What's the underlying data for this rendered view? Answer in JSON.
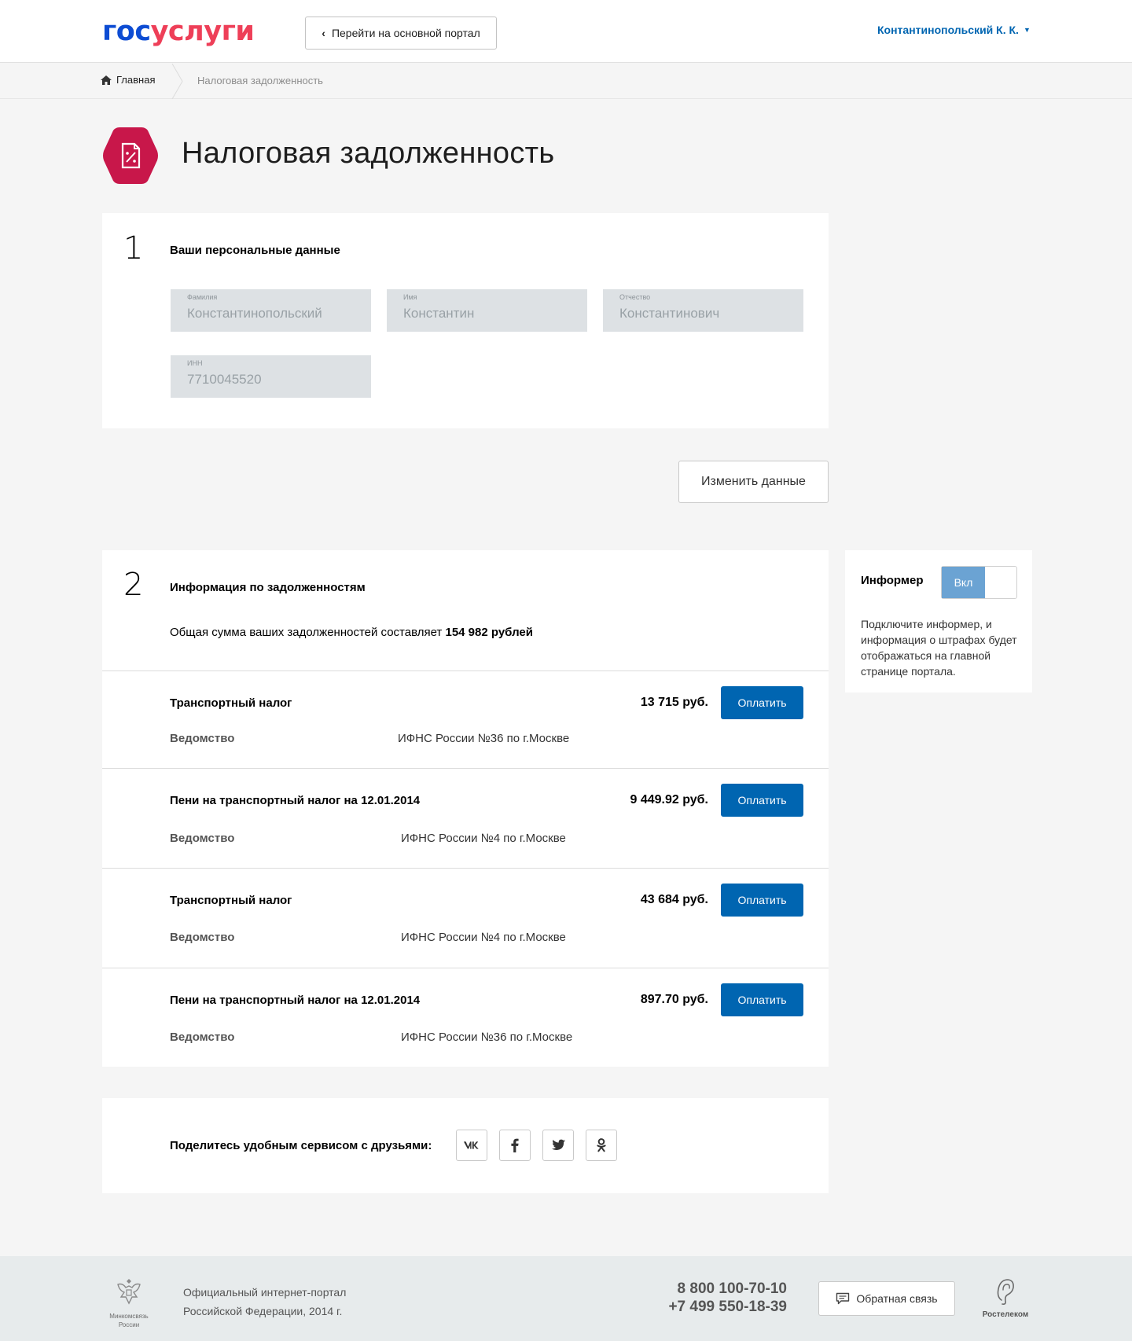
{
  "header": {
    "logo_part1": "гос",
    "logo_part2": "услуги",
    "portal_button": "Перейти на основной портал",
    "user_name": "Контантинопольский К. К."
  },
  "breadcrumb": {
    "home": "Главная",
    "current": "Налоговая задолженность"
  },
  "page_title": "Налоговая задолженность",
  "section1": {
    "number": "1",
    "heading": "Ваши персональные данные",
    "fields": [
      {
        "label": "Фамилия",
        "value": "Константинопольский"
      },
      {
        "label": "Имя",
        "value": "Константин"
      },
      {
        "label": "Отчество",
        "value": "Константинович"
      },
      {
        "label": "ИНН",
        "value": "7710045520"
      }
    ],
    "edit_button": "Изменить данные"
  },
  "section2": {
    "number": "2",
    "heading": "Информация по задолженностям",
    "total_prefix": "Общая сумма ваших задолженностей составляет",
    "total_amount": "154 982 рублей",
    "pay_label": "Оплатить",
    "dept_label": "Ведомство",
    "debts": [
      {
        "title": "Транспортный налог",
        "amount": "13 715 руб.",
        "department": "ИФНС России №36 по г.Москве"
      },
      {
        "title": "Пени на транспортный налог на 12.01.2014",
        "amount": "9 449.92 руб.",
        "department": "ИФНС России №4 по г.Москве"
      },
      {
        "title": "Транспортный налог",
        "amount": "43 684 руб.",
        "department": "ИФНС России №4 по г.Москве"
      },
      {
        "title": "Пени на транспортный налог на 12.01.2014",
        "amount": "897.70 руб.",
        "department": "ИФНС России №36 по г.Москве"
      }
    ]
  },
  "informer": {
    "title": "Информер",
    "toggle_on": "Вкл",
    "text": "Подключите информер, и информация о штрафах будет отображаться на главной странице портала."
  },
  "share": {
    "label": "Поделитесь удобным сервисом с друзьями:",
    "networks": [
      "vk-icon",
      "facebook-icon",
      "twitter-icon",
      "odnoklassniki-icon"
    ]
  },
  "footer": {
    "ministry": "Минкомсвязь России",
    "portal_line1": "Официальный интернет-портал",
    "portal_line2": "Российской Федерации, 2014 г.",
    "phone1": "8 800 100-70-10",
    "phone2": "+7 499 550-18-39",
    "feedback_button": "Обратная связь",
    "operator": "Ростелеком"
  },
  "colors": {
    "brand_blue": "#0d4cd3",
    "brand_red": "#ee3f58",
    "icon_crimson": "#c8174a",
    "button_blue": "#0065b1",
    "toggle_on": "#6ba3d3"
  }
}
